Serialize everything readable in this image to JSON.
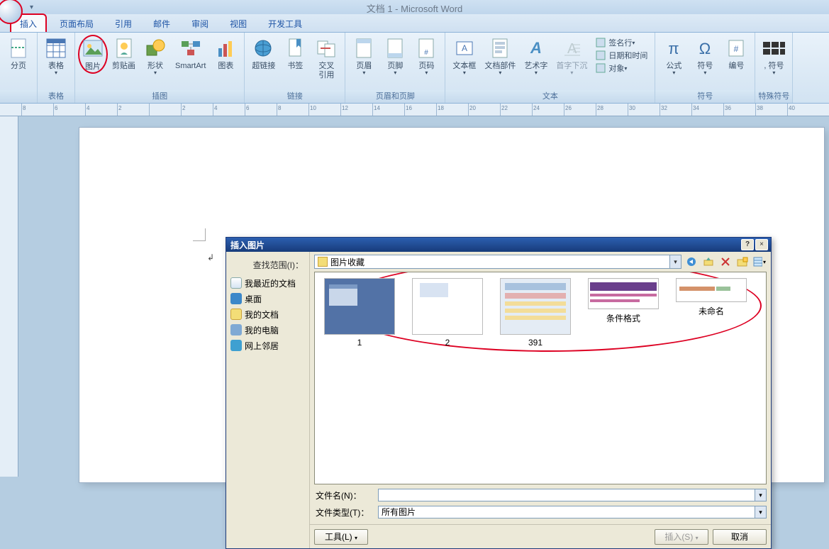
{
  "app_title": "文档 1 - Microsoft Word",
  "tabs": [
    "插入",
    "页面布局",
    "引用",
    "邮件",
    "审阅",
    "视图",
    "开发工具"
  ],
  "active_tab": "插入",
  "ribbon": {
    "groups": [
      {
        "label": "",
        "items": [
          {
            "name": "break",
            "cap": "分页"
          }
        ],
        "width": 40
      },
      {
        "label": "表格",
        "items": [
          {
            "name": "table",
            "cap": "表格",
            "arrow": true
          }
        ]
      },
      {
        "label": "插图",
        "items": [
          {
            "name": "picture",
            "cap": "图片",
            "circled": true
          },
          {
            "name": "clipart",
            "cap": "剪贴画"
          },
          {
            "name": "shapes",
            "cap": "形状",
            "arrow": true
          },
          {
            "name": "smartart",
            "cap": "SmartArt"
          },
          {
            "name": "chart",
            "cap": "图表"
          }
        ]
      },
      {
        "label": "链接",
        "items": [
          {
            "name": "hyperlink",
            "cap": "超链接"
          },
          {
            "name": "bookmark",
            "cap": "书签"
          },
          {
            "name": "crossref",
            "cap": "交叉\n引用"
          }
        ]
      },
      {
        "label": "页眉和页脚",
        "items": [
          {
            "name": "header",
            "cap": "页眉",
            "arrow": true
          },
          {
            "name": "footer",
            "cap": "页脚",
            "arrow": true
          },
          {
            "name": "pagenum",
            "cap": "页码",
            "arrow": true
          }
        ]
      },
      {
        "label": "文本",
        "items": [
          {
            "name": "textbox",
            "cap": "文本框",
            "arrow": true
          },
          {
            "name": "quickparts",
            "cap": "文档部件",
            "arrow": true
          },
          {
            "name": "wordart",
            "cap": "艺术字",
            "arrow": true
          },
          {
            "name": "dropcap",
            "cap": "首字下沉",
            "arrow": true,
            "disabled": true
          }
        ],
        "stack": [
          {
            "name": "sigline",
            "cap": "签名行"
          },
          {
            "name": "datetime",
            "cap": "日期和时间"
          },
          {
            "name": "object",
            "cap": "对象"
          }
        ]
      },
      {
        "label": "符号",
        "items": [
          {
            "name": "equation",
            "cap": "公式",
            "arrow": true
          },
          {
            "name": "symbol",
            "cap": "符号",
            "arrow": true
          },
          {
            "name": "number",
            "cap": "编号"
          }
        ]
      },
      {
        "label": "特殊符号",
        "items": [
          {
            "name": "specsym",
            "cap": ", 符号 ",
            "arrow": true
          }
        ]
      }
    ]
  },
  "dialog": {
    "title": "插入图片",
    "look_label": "查找范围(I)：",
    "path": "图片收藏",
    "sidebar": [
      {
        "name": "recent",
        "label": "我最近的文档"
      },
      {
        "name": "desktop",
        "label": "桌面"
      },
      {
        "name": "mydocs",
        "label": "我的文档"
      },
      {
        "name": "mycomputer",
        "label": "我的电脑"
      },
      {
        "name": "network",
        "label": "网上邻居"
      }
    ],
    "thumbs": [
      "1",
      "2",
      "391",
      "条件格式",
      "未命名"
    ],
    "filename_label": "文件名(N)：",
    "filetype_label": "文件类型(T)：",
    "filetype_value": "所有图片",
    "tools_btn": "工具(L)",
    "insert_btn": "插入(S)",
    "cancel_btn": "取消",
    "help_btn": "?",
    "close_btn": "×"
  },
  "ruler_marks": [
    "8",
    "6",
    "4",
    "2",
    "",
    "2",
    "4",
    "6",
    "8",
    "10",
    "12",
    "14",
    "16",
    "18",
    "20",
    "22",
    "24",
    "26",
    "28",
    "30",
    "32",
    "34",
    "36",
    "38",
    "40"
  ]
}
